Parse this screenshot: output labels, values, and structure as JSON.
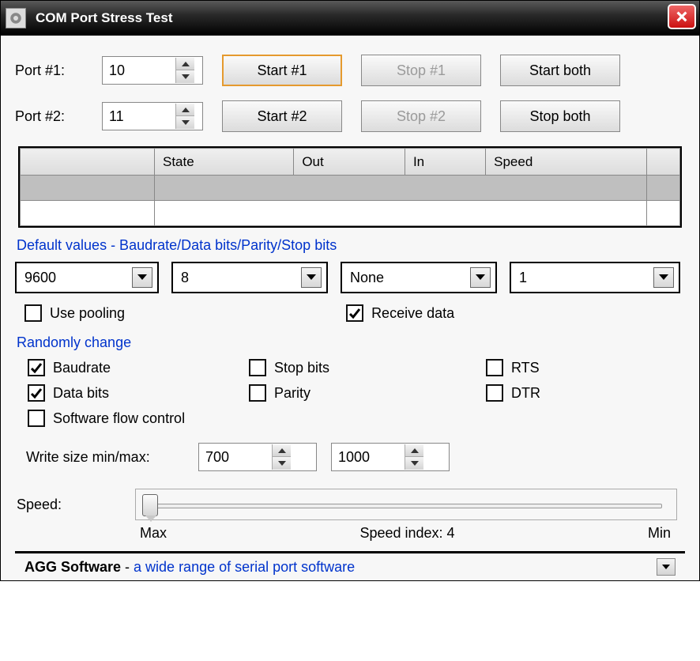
{
  "window": {
    "title": "COM Port Stress Test"
  },
  "ports": {
    "row1": {
      "label": "Port #1:",
      "value": "10",
      "start_label": "Start #1",
      "stop_label": "Stop #1",
      "both_label": "Start both"
    },
    "row2": {
      "label": "Port #2:",
      "value": "11",
      "start_label": "Start #2",
      "stop_label": "Stop #2",
      "both_label": "Stop both"
    }
  },
  "grid": {
    "headers": {
      "state": "State",
      "out": "Out",
      "in": "In",
      "speed": "Speed"
    }
  },
  "defaults": {
    "title": "Default values - Baudrate/Data bits/Parity/Stop bits",
    "baudrate": "9600",
    "data_bits": "8",
    "parity": "None",
    "stop_bits": "1",
    "use_pooling_label": "Use pooling",
    "receive_data_label": "Receive data",
    "use_pooling_checked": false,
    "receive_data_checked": true
  },
  "random": {
    "title": "Randomly change",
    "baudrate": {
      "label": "Baudrate",
      "checked": true
    },
    "data_bits": {
      "label": "Data bits",
      "checked": true
    },
    "sw_flow": {
      "label": "Software flow control",
      "checked": false
    },
    "stop_bits": {
      "label": "Stop bits",
      "checked": false
    },
    "parity": {
      "label": "Parity",
      "checked": false
    },
    "rts": {
      "label": "RTS",
      "checked": false
    },
    "dtr": {
      "label": "DTR",
      "checked": false
    },
    "write_label": "Write size min/max:",
    "write_min": "700",
    "write_max": "1000"
  },
  "speed": {
    "label": "Speed:",
    "max_label": "Max",
    "index_label": "Speed index: 4",
    "min_label": "Min"
  },
  "status": {
    "brand": "AGG Software",
    "dash": " - ",
    "tagline": "a wide range of serial port software"
  }
}
